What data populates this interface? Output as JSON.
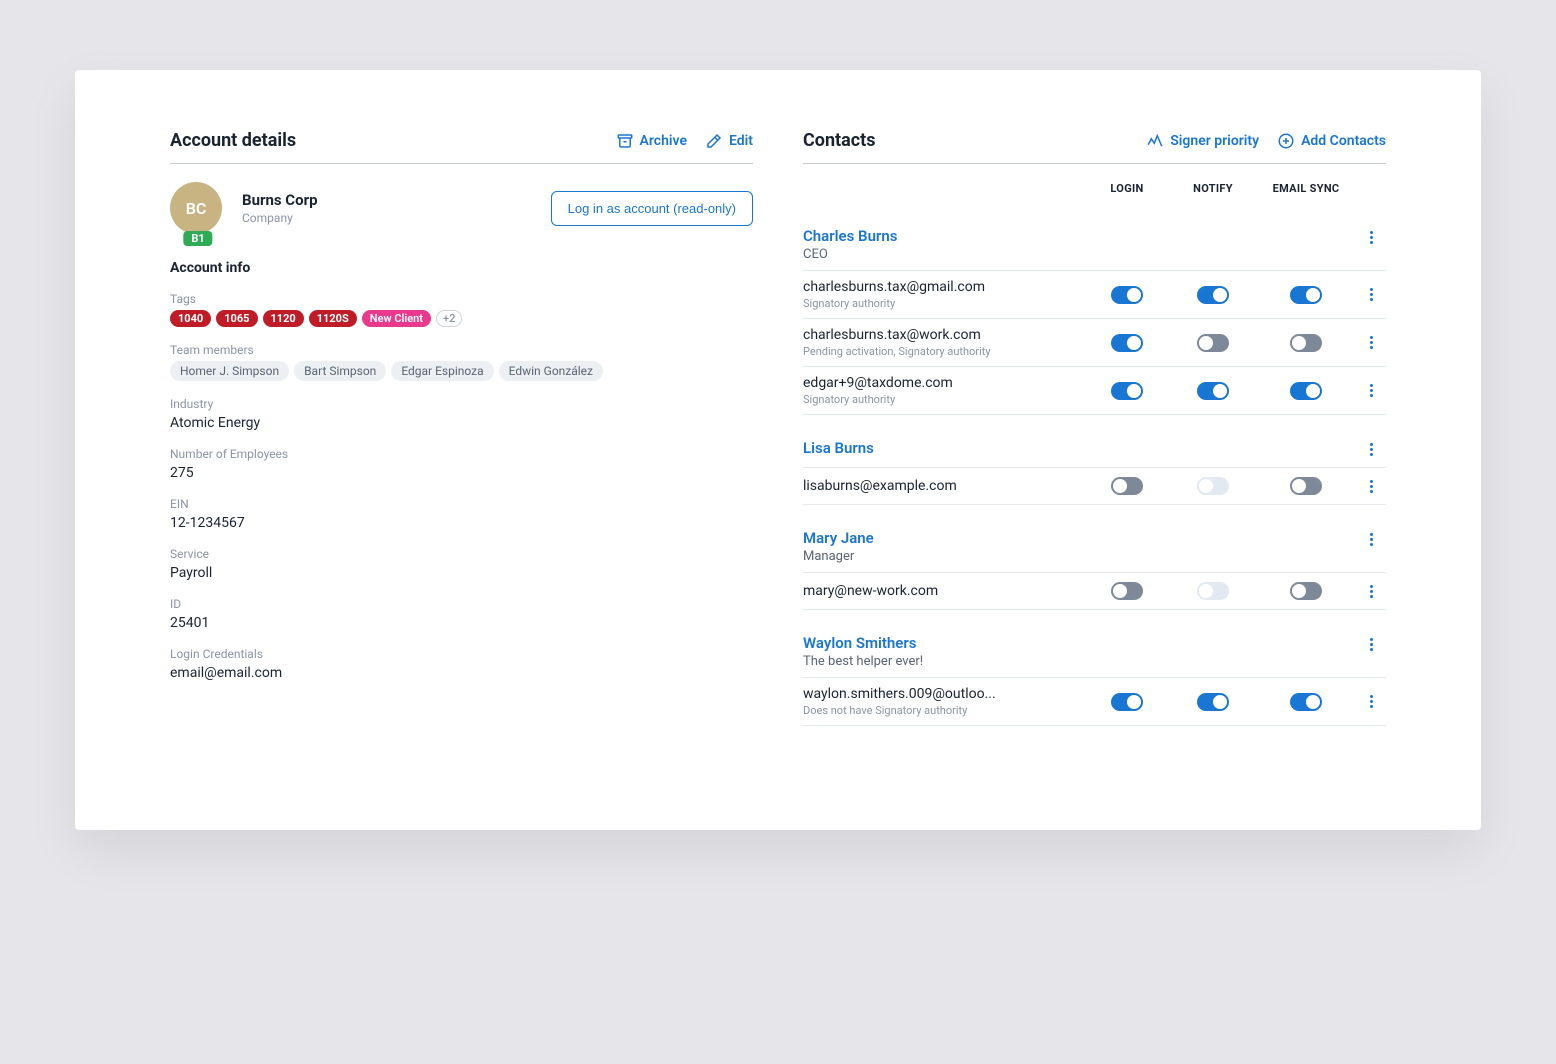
{
  "left": {
    "title": "Account details",
    "archive_label": "Archive",
    "edit_label": "Edit",
    "avatar_initials": "BC",
    "plan_badge": "B1",
    "account_name": "Burns Corp",
    "account_type": "Company",
    "login_as_label": "Log in as account (read-only)",
    "info_title": "Account info",
    "tags_label": "Tags",
    "tags": [
      "1040",
      "1065",
      "1120",
      "1120S"
    ],
    "new_client_tag": "New Client",
    "more_tags": "+2",
    "team_label": "Team members",
    "team": [
      "Homer J. Simpson",
      "Bart Simpson",
      "Edgar Espinoza",
      "Edwin González"
    ],
    "industry_label": "Industry",
    "industry_value": "Atomic Energy",
    "employees_label": "Number of Employees",
    "employees_value": "275",
    "ein_label": "EIN",
    "ein_value": "12-1234567",
    "service_label": "Service",
    "service_value": "Payroll",
    "id_label": "ID",
    "id_value": "25401",
    "login_creds_label": "Login Credentials",
    "login_creds_value": "email@email.com"
  },
  "right": {
    "title": "Contacts",
    "signer_label": "Signer priority",
    "add_label": "Add Contacts",
    "col_login": "LOGIN",
    "col_notify": "NOTIFY",
    "col_email_sync": "EMAIL SYNC",
    "contacts": [
      {
        "name": "Charles Burns",
        "role": "CEO",
        "emails": [
          {
            "addr": "charlesburns.tax@gmail.com",
            "note": "Signatory authority",
            "login": "on",
            "notify": "on",
            "sync": "on"
          },
          {
            "addr": "charlesburns.tax@work.com",
            "note": "Pending activation, Signatory authority",
            "login": "on",
            "notify": "off-dark",
            "sync": "off-dark"
          },
          {
            "addr": "edgar+9@taxdome.com",
            "note": "Signatory authority",
            "login": "on",
            "notify": "on",
            "sync": "on"
          }
        ]
      },
      {
        "name": "Lisa Burns",
        "role": "",
        "emails": [
          {
            "addr": "lisaburns@example.com",
            "note": "",
            "login": "off-dark",
            "notify": "off-light",
            "sync": "off-dark"
          }
        ]
      },
      {
        "name": "Mary Jane",
        "role": "Manager",
        "emails": [
          {
            "addr": "mary@new-work.com",
            "note": "",
            "login": "off-dark",
            "notify": "off-light",
            "sync": "off-dark"
          }
        ]
      },
      {
        "name": "Waylon Smithers",
        "role": "The best helper ever!",
        "emails": [
          {
            "addr": "waylon.smithers.009@outloo...",
            "note": "Does not have Signatory authority",
            "login": "on",
            "notify": "on",
            "sync": "on"
          }
        ]
      }
    ]
  }
}
